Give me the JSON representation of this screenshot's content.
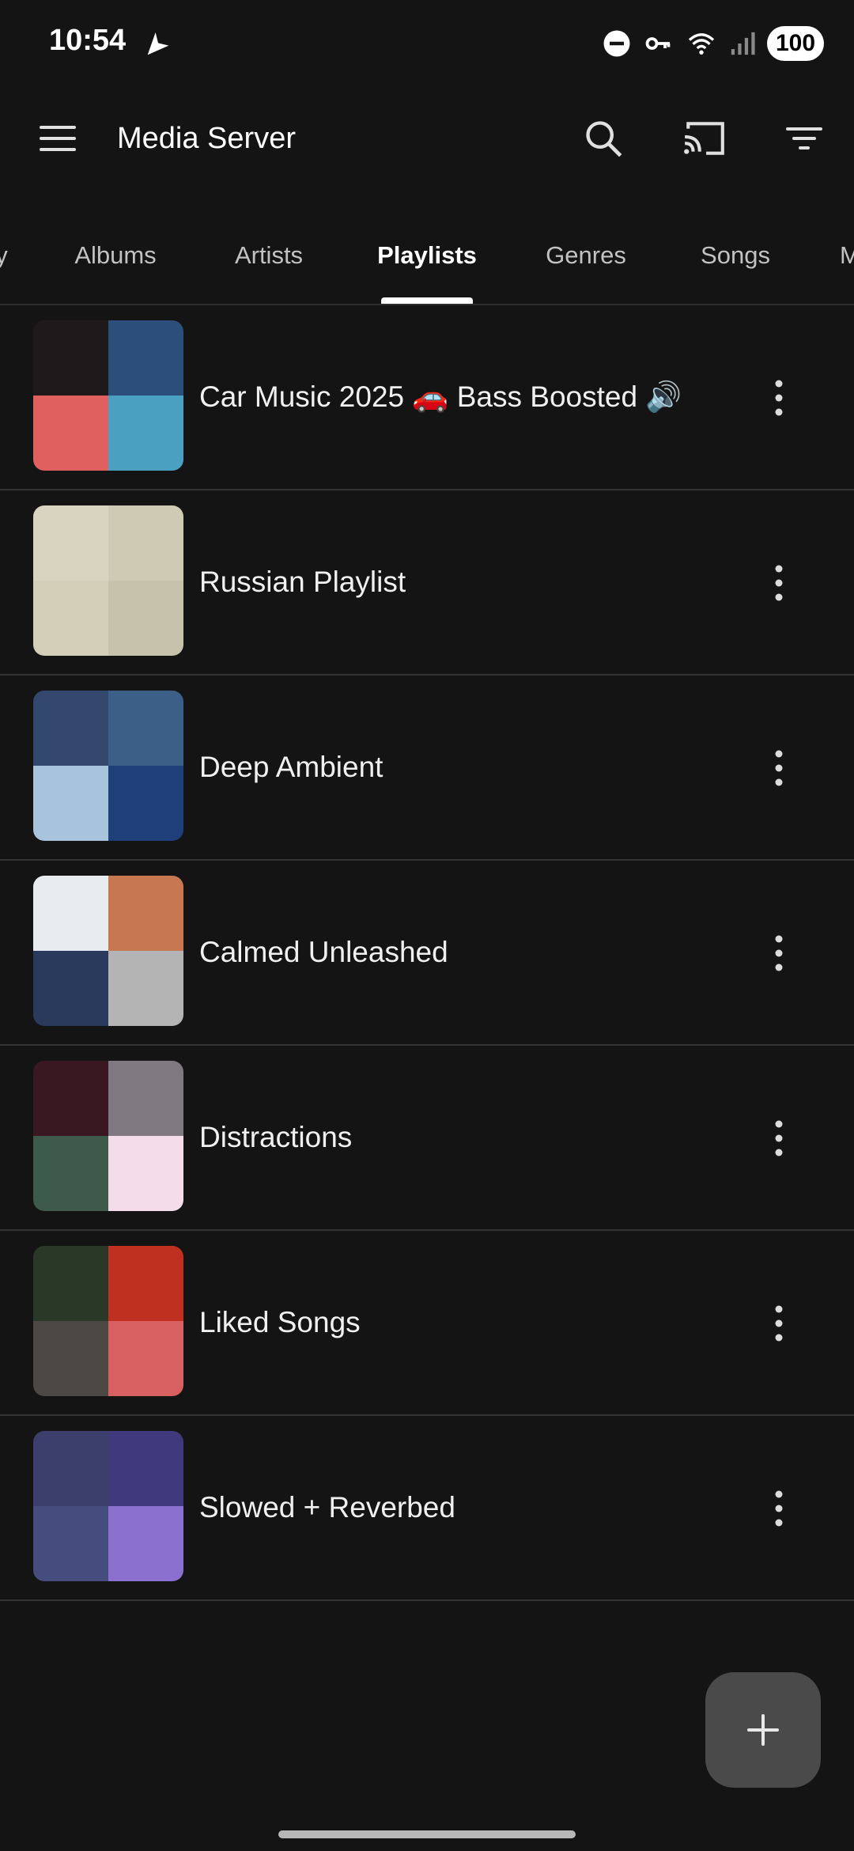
{
  "status_bar": {
    "time": "10:54",
    "battery": "100",
    "icons": [
      "navigation-icon",
      "do-not-disturb-icon",
      "vpn-key-icon",
      "wifi-icon",
      "signal-icon"
    ]
  },
  "app_bar": {
    "title": "Media Server",
    "icons": [
      "menu-icon",
      "search-icon",
      "cast-icon",
      "filter-icon"
    ]
  },
  "tabs": [
    {
      "label": "y"
    },
    {
      "label": "Albums"
    },
    {
      "label": "Artists"
    },
    {
      "label": "Playlists",
      "active": true
    },
    {
      "label": "Genres"
    },
    {
      "label": "Songs"
    },
    {
      "label": "M"
    }
  ],
  "playlists": [
    {
      "title": "Car Music 2025 🚗 Bass Boosted 🔊",
      "art_colors": [
        "#1e1a1c",
        "#2c4e7a",
        "#e06060",
        "#4aa0c0"
      ]
    },
    {
      "title": "Russian Playlist",
      "art_colors": [
        "#d8d4c0",
        "#cfcab4",
        "#d4cfb8",
        "#c6c2ac"
      ]
    },
    {
      "title": "Deep Ambient",
      "art_colors": [
        "#34486e",
        "#3b5f86",
        "#a8c4dc",
        "#1f3f7a"
      ]
    },
    {
      "title": "Calmed Unleashed",
      "art_colors": [
        "#e6ecf0",
        "#c87850",
        "#2a3a5c",
        "#b4b4b4"
      ]
    },
    {
      "title": "Distractions",
      "art_colors": [
        "#3a1822",
        "#807880",
        "#3e5a4a",
        "#f4dce8"
      ]
    },
    {
      "title": "Liked Songs",
      "art_colors": [
        "#2a3828",
        "#c03020",
        "#4c4844",
        "#d86060"
      ]
    },
    {
      "title": "Slowed + Reverbed",
      "art_colors": [
        "#3c3e6c",
        "#403a7c",
        "#464c7e",
        "#8c70d0"
      ]
    }
  ],
  "fab": {
    "icon": "plus-icon"
  }
}
